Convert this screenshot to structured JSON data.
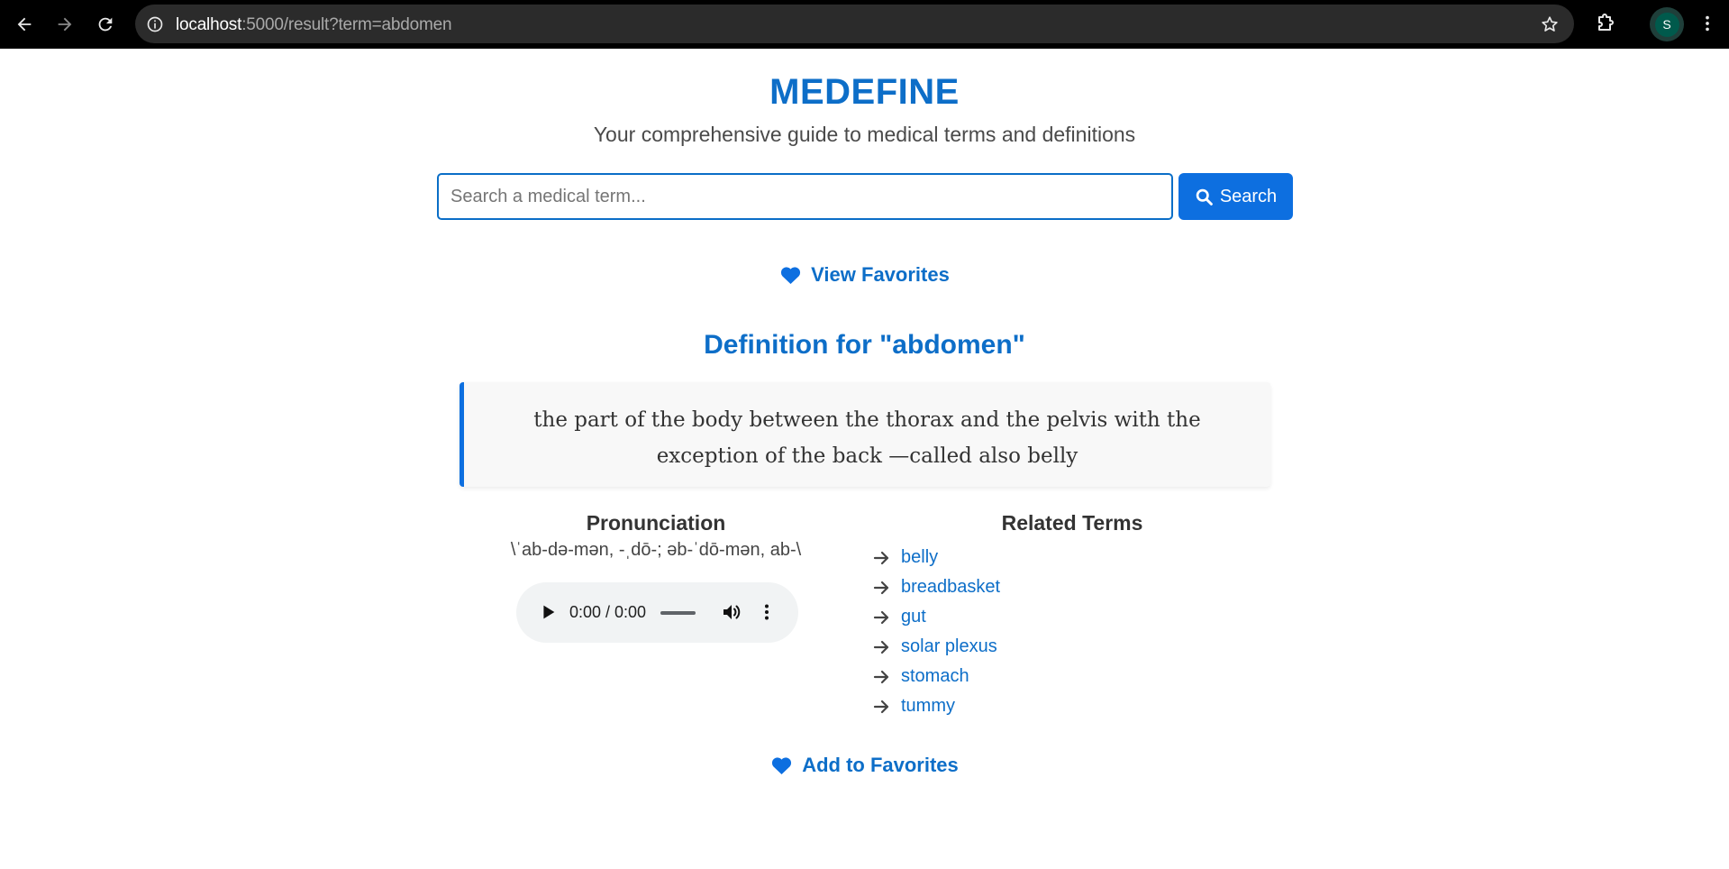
{
  "browser": {
    "url_host": "localhost",
    "url_path": ":5000/result?term=abdomen",
    "profile_initial": "S"
  },
  "header": {
    "title": "MEDEFINE",
    "subtitle": "Your comprehensive guide to medical terms and definitions"
  },
  "search": {
    "placeholder": "Search a medical term...",
    "value": "",
    "button_label": "Search"
  },
  "view_favorites_label": "View Favorites",
  "definition": {
    "heading": "Definition for \"abdomen\"",
    "text": "the part of the body between the thorax and the pelvis with the exception of the back —called also belly"
  },
  "pronunciation": {
    "heading": "Pronunciation",
    "text": "\\ˈab-də-mən, -ˌdō-; əb-ˈdō-mən, ab-\\",
    "audio_time": "0:00 / 0:00"
  },
  "related": {
    "heading": "Related Terms",
    "terms": [
      "belly",
      "breadbasket",
      "gut",
      "solar plexus",
      "stomach",
      "tummy"
    ]
  },
  "add_favorites_label": "Add to Favorites",
  "colors": {
    "brand_blue": "#0d6ec8",
    "button_blue": "#0d6fe0",
    "chrome_bg": "#000000"
  },
  "icons": [
    "back-arrow-icon",
    "forward-arrow-icon",
    "reload-icon",
    "site-info-icon",
    "star-icon",
    "extensions-icon",
    "kebab-menu-icon",
    "search-icon",
    "heart-icon",
    "play-icon",
    "volume-icon",
    "arrow-right-icon"
  ]
}
